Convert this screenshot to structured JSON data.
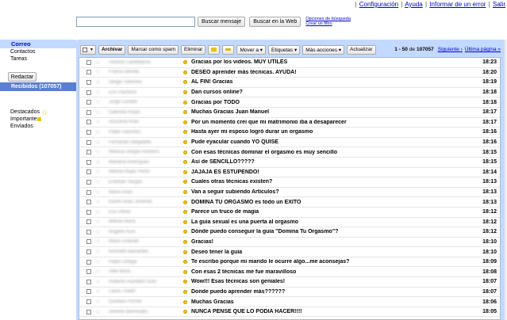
{
  "top_links": [
    "Configuración",
    "Ayuda",
    "Informar de un error",
    "Salir"
  ],
  "search": {
    "placeholder": "",
    "search_mail": "Buscar mensaje",
    "search_web": "Buscar en la Web",
    "options": "Opciones de búsqueda",
    "create_filter": "Crear un filtro"
  },
  "sidebar": {
    "mail": "Correo",
    "contacts": "Contactos",
    "tasks": "Tareas",
    "compose": "Redactar",
    "inbox": "Recibidos (107057)",
    "starred": "Destacados",
    "important": "Importante",
    "sent": "Enviados"
  },
  "toolbar": {
    "archive": "Archivar",
    "spam": "Marcar como spam",
    "delete": "Eliminar",
    "move": "Mover a ▾",
    "labels": "Etiquetas ▾",
    "more": "Más acciones ▾",
    "refresh": "Actualizar",
    "range": "1 - 50",
    "of": "de",
    "total": "107057",
    "next": "Siguiente ›",
    "last": "Última página »"
  },
  "colors": {
    "accent": "#c3d9ff",
    "inbox_selected": "#5a7fd0",
    "link": "#0000cc",
    "important": "#f1c40f"
  },
  "messages": [
    {
      "sender": "Victoria Castellanos",
      "subject": "Gracias por los videos. MUY ÚTILES",
      "time": "18:23"
    },
    {
      "sender": "Franco Bevilla",
      "subject": "DESEO aprender más técnicas. AYUDA!",
      "time": "18:20"
    },
    {
      "sender": "Sergio Sánchez",
      "subject": "AL FIN! Gracias",
      "time": "18:19"
    },
    {
      "sender": "Eric Pacheco",
      "subject": "Dan cursos online?",
      "time": "18:18"
    },
    {
      "sender": "Jorge Cordier",
      "subject": "Gracias por TODO",
      "time": "18:18"
    },
    {
      "sender": "Gabriela Rojas",
      "subject": "Muchas Gracias Juan Manuel",
      "time": "18:17"
    },
    {
      "sender": "Azucena Arias",
      "subject": "Por un momento creí que mi matrimonio iba a desaparecer",
      "time": "18:17"
    },
    {
      "sender": "Pablo Sánchez",
      "subject": "Hasta ayer mi esposo logró durar un orgasmo",
      "time": "18:16"
    },
    {
      "sender": "Fernando Delgadillo",
      "subject": "Pude eyacular cuando YO QUISE",
      "time": "18:16"
    },
    {
      "sender": "Melissa Vargas Romero",
      "subject": "Con esas técnicas dominar el orgasmo es muy sencillo",
      "time": "18:15"
    },
    {
      "sender": "Mariana Rodríguez",
      "subject": "Así de SENCILLO?????",
      "time": "18:15"
    },
    {
      "sender": "Melina Rojas Pérez",
      "subject": "JAJAJA ES ESTUPENDO!",
      "time": "18:14"
    },
    {
      "sender": "Esteban Vargas",
      "subject": "Cuales otras técnicas existen?",
      "time": "18:13"
    },
    {
      "sender": "Mario Arias",
      "subject": "Van a seguir subiendo Artículos?",
      "time": "18:13"
    },
    {
      "sender": "Karen Arias Jiménez",
      "subject": "DOMINA TU ORGASMO es todo un ÉXITO",
      "time": "18:13"
    },
    {
      "sender": "Eric Pérez",
      "subject": "Parece un truco de magia",
      "time": "18:12"
    },
    {
      "sender": "Milfred Mora",
      "subject": "La guía sexual es una puerta al orgasmo",
      "time": "18:12"
    },
    {
      "sender": "Rogelio Azul",
      "subject": "Dónde puedo conseguir la guía \"Domina Tu Orgasmo\"?",
      "time": "18:12"
    },
    {
      "sender": "Mario Orlando",
      "subject": "Gracias!",
      "time": "18:10"
    },
    {
      "sender": "Kenneth Barrantes",
      "subject": "Deseo tener la guía",
      "time": "18:10"
    },
    {
      "sender": "Pablo Ortega",
      "subject": "Te escribo porque mi marido le ocurre algo...me aconsejas?",
      "time": "18:09"
    },
    {
      "sender": "Aldo Mora",
      "subject": "Con esas 2 técnicas me fue maravilloso",
      "time": "18:08"
    },
    {
      "sender": "Roberto Humbert Soto",
      "subject": "Wow!!! Esas técnicas son geniales!",
      "time": "18:07"
    },
    {
      "sender": "Laura Tirado",
      "subject": "Donde puedo aprender más??????",
      "time": "18:07"
    },
    {
      "sender": "Gustavo Porras",
      "subject": "Muchas Gracias",
      "time": "18:06"
    },
    {
      "sender": "Antonio Bermúdez",
      "subject": "NUNCA PENSÉ QUE LO PODÍA HACER!!!!",
      "time": "18:05"
    }
  ]
}
